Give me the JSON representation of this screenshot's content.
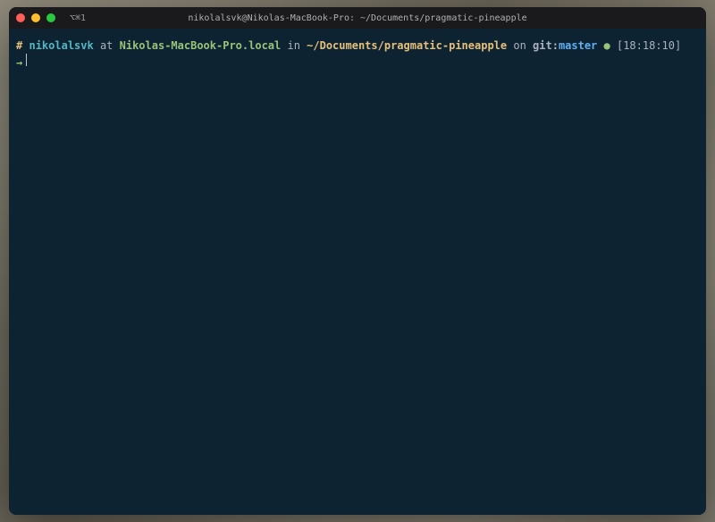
{
  "titlebar": {
    "tab_label": "⌥⌘1",
    "window_title": "nikolalsvk@Nikolas-MacBook-Pro: ~/Documents/pragmatic-pineapple"
  },
  "prompt": {
    "hash": "#",
    "user": "nikolalsvk",
    "at": " at ",
    "host": "Nikolas-MacBook-Pro.local",
    "in": " in ",
    "path": "~/Documents/pragmatic-pineapple",
    "on": " on ",
    "git_label": "git:",
    "branch": "master",
    "status_dot": " ● ",
    "time": "[18:18:10]",
    "arrow": "→"
  },
  "colors": {
    "terminal_bg": "#0d2332",
    "titlebar_bg": "#1a1a1c",
    "yellow": "#e5c07b",
    "cyan": "#56b6c2",
    "green": "#98c379",
    "blue": "#61afef",
    "fg": "#abb2bf"
  }
}
